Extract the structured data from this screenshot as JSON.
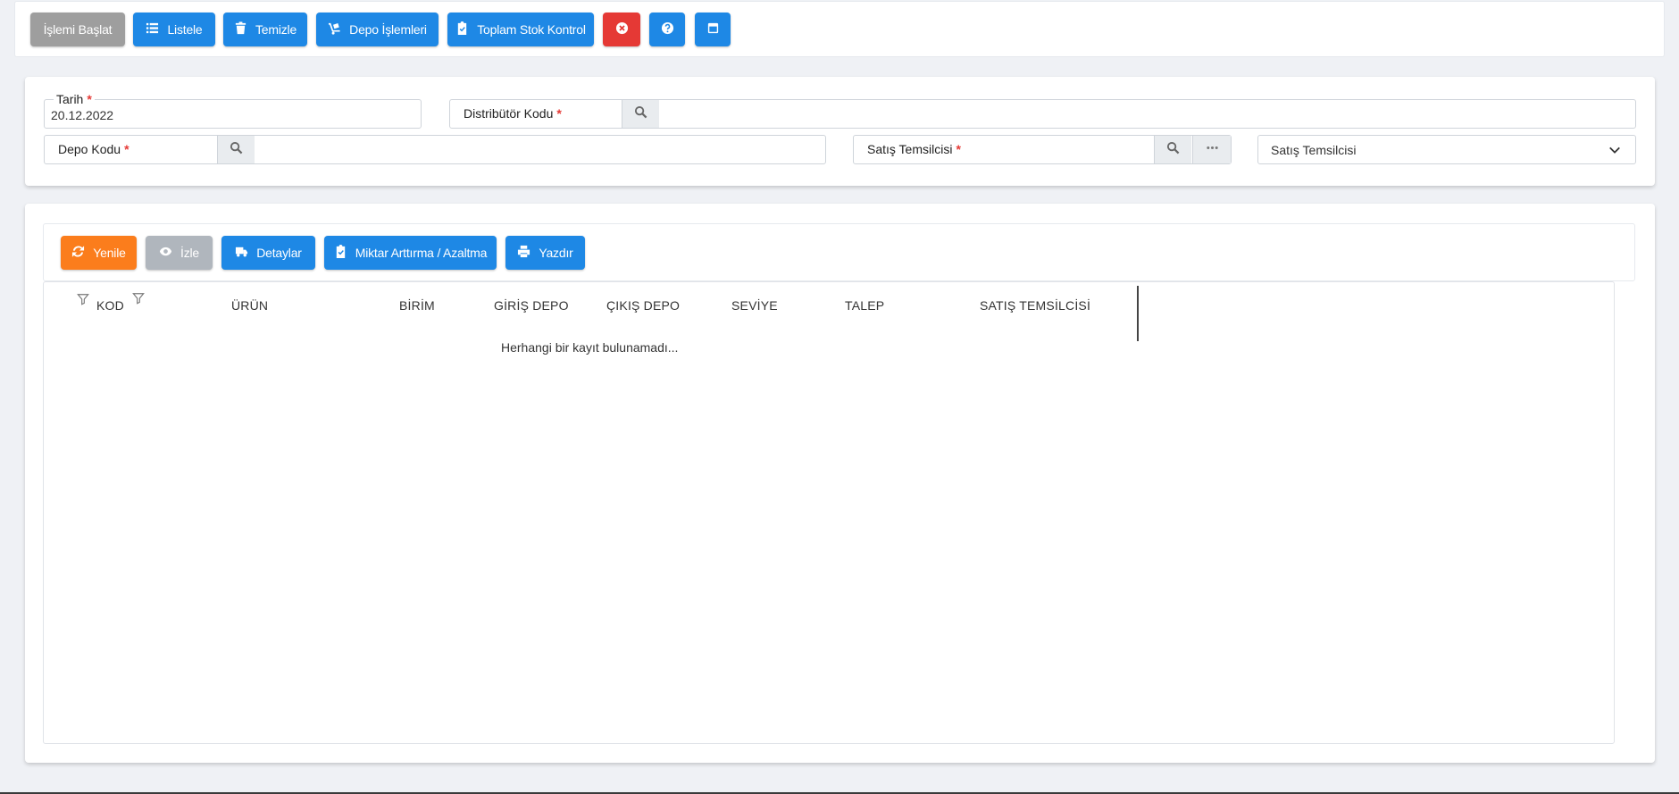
{
  "toolbar": {
    "start_label": "İşlemi Başlat",
    "list_label": "Listele",
    "clear_label": "Temizle",
    "warehouse_ops_label": "Depo İşlemleri",
    "total_stock_label": "Toplam Stok Kontrol"
  },
  "form": {
    "date_label": "Tarih",
    "date_value": "20.12.2022",
    "distributor_label": "Distribütör Kodu",
    "warehouse_label": "Depo Kodu",
    "sales_rep_label": "Satış Temsilcisi",
    "sales_rep_select_value": "Satış Temsilcisi",
    "required_mark": "*"
  },
  "grid_toolbar": {
    "refresh_label": "Yenile",
    "view_label": "İzle",
    "details_label": "Detaylar",
    "quantity_label": "Miktar Arttırma / Azaltma",
    "print_label": "Yazdır"
  },
  "grid": {
    "columns": [
      "KOD",
      "ÜRÜN",
      "BİRİM",
      "GİRİŞ DEPO",
      "ÇIKIŞ DEPO",
      "SEVİYE",
      "TALEP",
      "SATIŞ TEMSİLCİSİ"
    ],
    "empty_message": "Herhangi bir kayıt bulunamadı..."
  },
  "colors": {
    "primary": "#1e88e5",
    "danger": "#e53935",
    "warning": "#fb7d1c",
    "disabled": "#9e9e9e"
  }
}
